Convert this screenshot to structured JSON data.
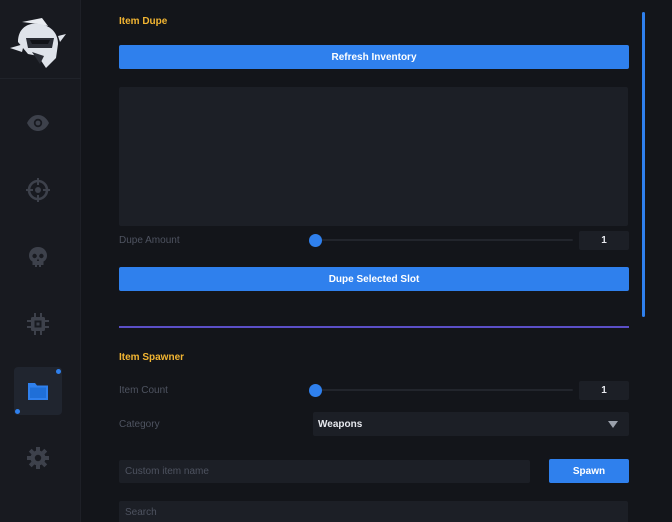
{
  "sidebar": {
    "logo": "knight-helmet-logo",
    "items": [
      {
        "icon": "eye-icon"
      },
      {
        "icon": "crosshair-icon"
      },
      {
        "icon": "skull-icon"
      },
      {
        "icon": "chip-icon"
      },
      {
        "icon": "folder-icon",
        "active": true
      },
      {
        "icon": "gear-icon"
      }
    ]
  },
  "item_dupe": {
    "title": "Item Dupe",
    "refresh_label": "Refresh Inventory",
    "dupe_amount_label": "Dupe Amount",
    "dupe_amount_value": "1",
    "dupe_button_label": "Dupe Selected Slot"
  },
  "item_spawner": {
    "title": "Item Spawner",
    "count_label": "Item Count",
    "count_value": "1",
    "category_label": "Category",
    "category_value": "Weapons",
    "custom_placeholder": "Custom item name",
    "spawn_label": "Spawn",
    "search_placeholder": "Search"
  },
  "colors": {
    "accent": "#2f80ed",
    "section_title": "#f2b532",
    "divider": "#5b4fc7",
    "background": "#13151a",
    "sidebar": "#181a20"
  }
}
